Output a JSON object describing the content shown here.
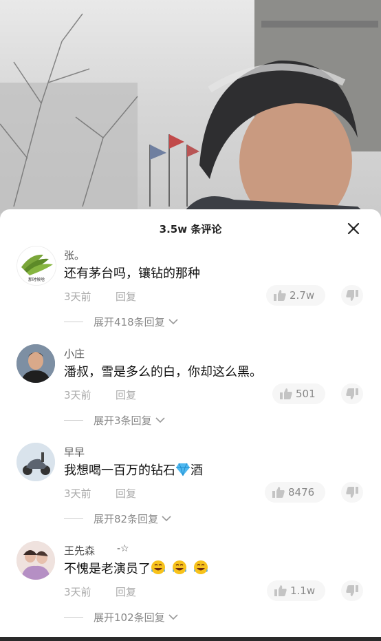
{
  "sheet": {
    "title": "3.5w 条评论"
  },
  "comments": [
    {
      "user": "张。",
      "avatar_caption": "那时候啥",
      "text": "还有茅台吗，镶钻的那种",
      "time": "3天前",
      "reply": "回复",
      "likes": "2.7w",
      "expand": "展开418条回复"
    },
    {
      "user": "小庄",
      "text": "潘叔，雪是多么的白，你却这么黑。",
      "time": "3天前",
      "reply": "回复",
      "likes": "501",
      "expand": "展开3条回复"
    },
    {
      "user": "早早",
      "text_before": "我想喝一百万的钻石",
      "text_after": "酒",
      "time": "3天前",
      "reply": "回复",
      "likes": "8476",
      "expand": "展开82条回复"
    },
    {
      "user": "王先森",
      "badge": "-☆",
      "text": "不愧是老演员了",
      "emojis": [
        "😂",
        "😂",
        "😂"
      ],
      "time": "3天前",
      "reply": "回复",
      "likes": "1.1w",
      "expand": "展开102条回复"
    }
  ],
  "icons": {
    "close": "close-icon",
    "like": "thumbs-up-icon",
    "dislike": "thumbs-down-icon",
    "chevron": "chevron-down-icon",
    "diamond": "gem-emoji",
    "laugh": "laughing-tears-emoji"
  },
  "colors": {
    "muted": "#aaaaaa",
    "text": "#111111",
    "pill_bg": "#f6f6f6"
  }
}
